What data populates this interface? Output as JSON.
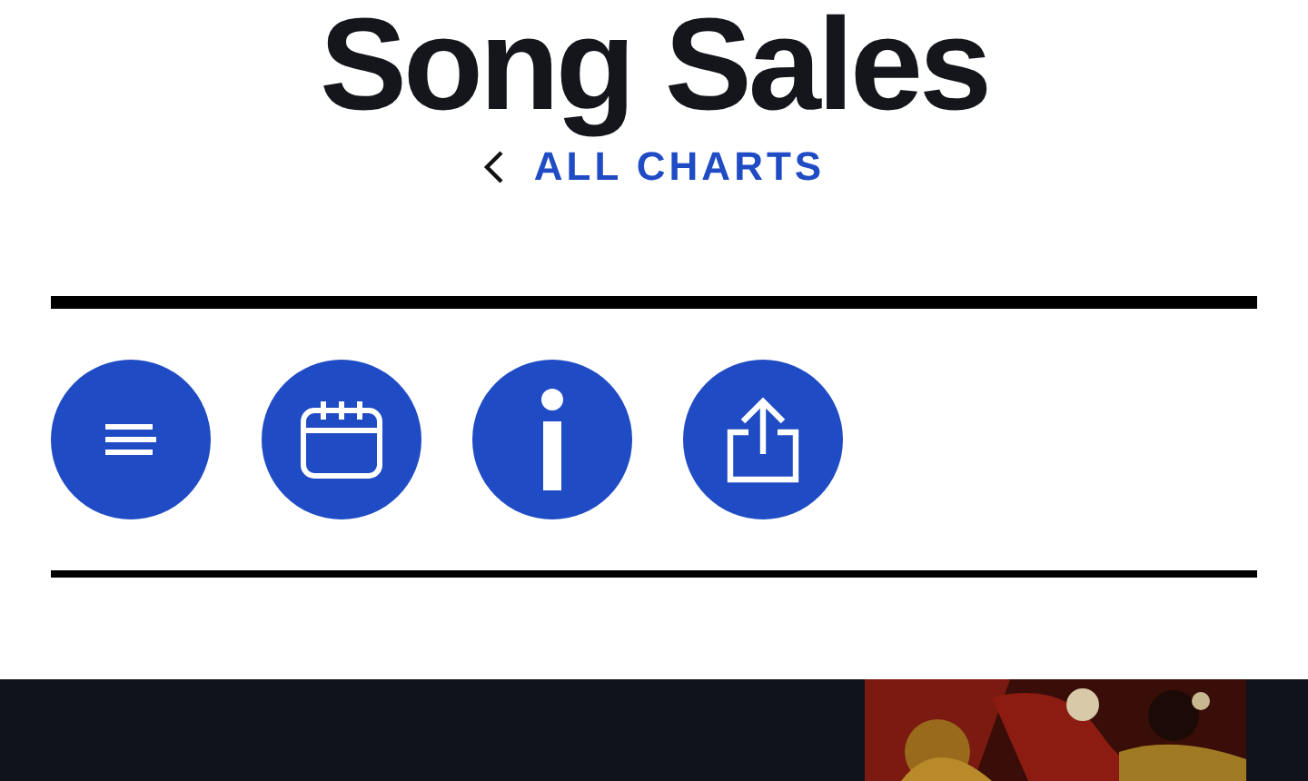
{
  "title": "Song Sales",
  "back_link": {
    "label": "ALL CHARTS"
  }
}
